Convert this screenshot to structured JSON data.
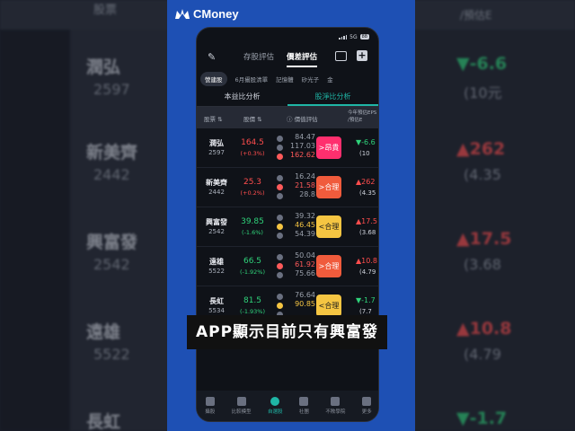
{
  "brand": {
    "name": "CMoney"
  },
  "background": {
    "header_left": "股票",
    "header_right": "/預估E",
    "rows": [
      {
        "name": "潤弘",
        "code": "2597",
        "pct": "▼-6.6",
        "sub": "(10元",
        "dir": "down"
      },
      {
        "name": "新美齊",
        "code": "2442",
        "pct": "▲262",
        "sub": "(4.35",
        "dir": "up"
      },
      {
        "name": "興富發",
        "code": "2542",
        "pct": "▲17.5",
        "sub": "(3.68",
        "dir": "up"
      },
      {
        "name": "遠雄",
        "code": "5522",
        "pct": "▲10.8",
        "sub": "(4.79",
        "dir": "up"
      },
      {
        "name": "長虹",
        "code": "",
        "pct": "▼-1.7",
        "sub": "",
        "dir": "down"
      }
    ]
  },
  "phone": {
    "status": {
      "network": "5G",
      "battery": "88"
    },
    "topbar": {
      "tabs": [
        {
          "label": "存股評估",
          "active": false
        },
        {
          "label": "價差評估",
          "active": true
        }
      ]
    },
    "chips": [
      {
        "label": "營建股",
        "active": true
      },
      {
        "label": "6月攝股清單",
        "active": false
      },
      {
        "label": "記憶體",
        "active": false
      },
      {
        "label": "矽光子",
        "active": false
      },
      {
        "label": "金",
        "active": false
      }
    ],
    "subtabs": [
      {
        "label": "本益比分析",
        "active": false
      },
      {
        "label": "股淨比分析",
        "active": true
      }
    ],
    "table_header": {
      "stock": "股票",
      "price": "股價",
      "valuation": "價值評估",
      "eps": "今年預估EPS",
      "eps2": "/預估E"
    },
    "rows": [
      {
        "name": "潤弘",
        "code": "2597",
        "price": "164.5",
        "chg": "(+0.3%)",
        "dir": "up",
        "v1": "84.47",
        "v2": "117.03",
        "v3": "162.62",
        "hl": 3,
        "hlclass": "hr",
        "badge": ">昂貴",
        "badge_color": "pink",
        "eps": "▼-6.6",
        "eps_dir": "down",
        "epsv": "(10"
      },
      {
        "name": "新美齊",
        "code": "2442",
        "price": "25.3",
        "chg": "(+0.2%)",
        "dir": "up",
        "v1": "16.24",
        "v2": "21.58",
        "v3": "28.8",
        "hl": 2,
        "hlclass": "hr",
        "badge": ">合理",
        "badge_color": "red",
        "eps": "▲262",
        "eps_dir": "up",
        "epsv": "(4.35"
      },
      {
        "name": "興富發",
        "code": "2542",
        "price": "39.85",
        "chg": "(-1.6%)",
        "dir": "down",
        "v1": "39.32",
        "v2": "46.45",
        "v3": "54.39",
        "hl": 2,
        "hlclass": "hl",
        "badge": "<合理",
        "badge_color": "yellow",
        "eps": "▲17.5",
        "eps_dir": "up",
        "epsv": "(3.68"
      },
      {
        "name": "遠雄",
        "code": "5522",
        "price": "66.5",
        "chg": "(-1.92%)",
        "dir": "down",
        "v1": "50.04",
        "v2": "61.92",
        "v3": "75.66",
        "hl": 2,
        "hlclass": "hr",
        "badge": ">合理",
        "badge_color": "red",
        "eps": "▲10.8",
        "eps_dir": "up",
        "epsv": "(4.79"
      },
      {
        "name": "長虹",
        "code": "5534",
        "price": "81.5",
        "chg": "(-1.93%)",
        "dir": "down",
        "v1": "76.64",
        "v2": "90.85",
        "v3": "",
        "hl": 2,
        "hlclass": "hl",
        "badge": "<合理",
        "badge_color": "yellow",
        "eps": "▼-1.7",
        "eps_dir": "down",
        "epsv": "(7.7"
      }
    ],
    "nav": [
      {
        "label": "攝股",
        "active": false
      },
      {
        "label": "比較模型",
        "active": false
      },
      {
        "label": "自選股",
        "active": true
      },
      {
        "label": "社團",
        "active": false
      },
      {
        "label": "不敗學院",
        "active": false
      },
      {
        "label": "更多",
        "active": false
      }
    ]
  },
  "caption": "APP顯示目前只有興富發",
  "colors": {
    "panel": "#1e50b4",
    "accent": "#1fb6a6",
    "up": "#ff4d4d",
    "down": "#2fd37a"
  }
}
